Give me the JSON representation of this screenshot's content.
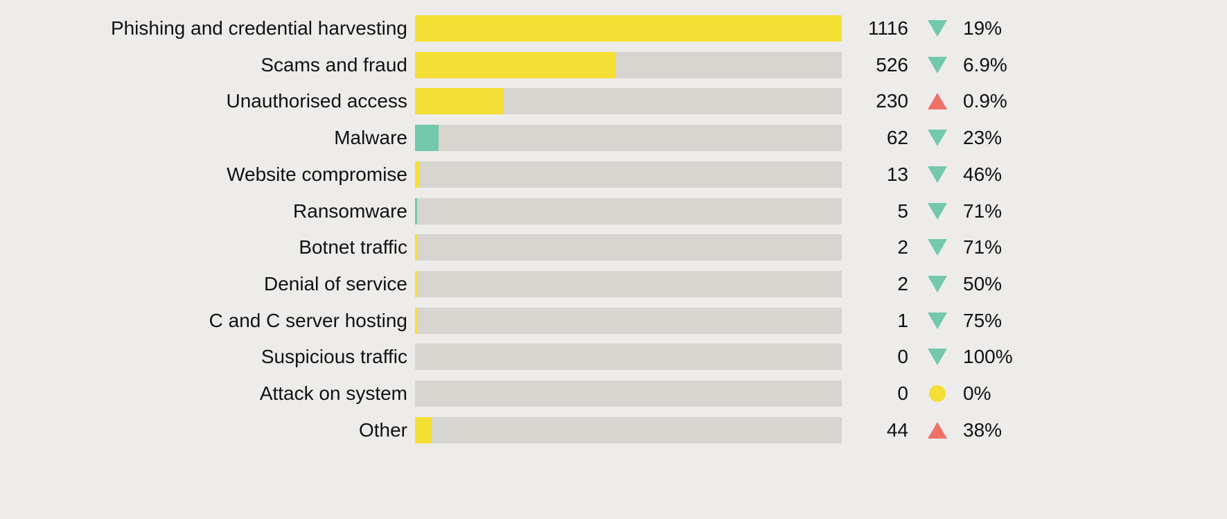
{
  "colors": {
    "background": "#EDECEA",
    "track": "#D6D5D0",
    "yellow": "#F5DF35",
    "teal": "#72C9AB",
    "up": "#EE7168",
    "down": "#72C9AB",
    "neutral": "#F5DF35"
  },
  "chart_data": {
    "type": "bar",
    "orientation": "horizontal",
    "title": "",
    "xlabel": "",
    "ylabel": "",
    "xlim": [
      0,
      1116
    ],
    "grid": false,
    "legend": "none",
    "categories": [
      "Phishing and credential harvesting",
      "Scams and fraud",
      "Unauthorised access",
      "Malware",
      "Website compromise",
      "Ransomware",
      "Botnet traffic",
      "Denial of service",
      "C and C server hosting",
      "Suspicious traffic",
      "Attack on system",
      "Other"
    ],
    "values": [
      1116,
      526,
      230,
      62,
      13,
      5,
      2,
      2,
      1,
      0,
      0,
      44
    ],
    "bar_colors": [
      "yellow",
      "yellow",
      "yellow",
      "teal",
      "yellow",
      "teal",
      "yellow",
      "yellow",
      "yellow",
      "yellow",
      "yellow",
      "yellow"
    ],
    "value_labels": [
      "1116",
      "526",
      "230",
      "62",
      "13",
      "5",
      "2",
      "2",
      "1",
      "0",
      "0",
      "44"
    ],
    "trend": [
      "down",
      "down",
      "up",
      "down",
      "down",
      "down",
      "down",
      "down",
      "down",
      "down",
      "neutral",
      "up"
    ],
    "trend_icons": [
      "triangle-down-icon",
      "triangle-down-icon",
      "triangle-up-icon",
      "triangle-down-icon",
      "triangle-down-icon",
      "triangle-down-icon",
      "triangle-down-icon",
      "triangle-down-icon",
      "triangle-down-icon",
      "triangle-down-icon",
      "circle-icon",
      "triangle-up-icon"
    ],
    "change_pct": [
      "19%",
      "6.9%",
      "0.9%",
      "23%",
      "46%",
      "71%",
      "71%",
      "50%",
      "75%",
      "100%",
      "0%",
      "38%"
    ]
  }
}
